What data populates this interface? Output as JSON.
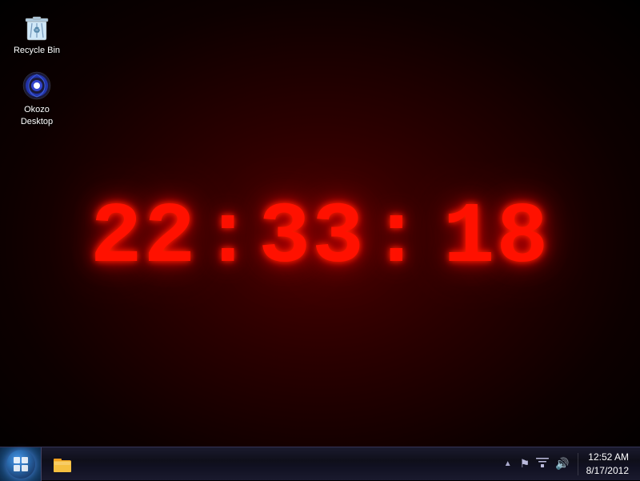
{
  "desktop": {
    "background": "radial dark red"
  },
  "icons": [
    {
      "id": "recycle-bin",
      "label": "Recycle Bin",
      "type": "recycle-bin"
    },
    {
      "id": "okozo-desktop",
      "label": "Okozo\nDesktop",
      "labelLine1": "Okozo",
      "labelLine2": "Desktop",
      "type": "okozo"
    }
  ],
  "clock": {
    "hours": "22",
    "minutes": "33",
    "seconds": "18",
    "display": "22:33: 18"
  },
  "taskbar": {
    "start_label": "Start",
    "pins": [
      {
        "label": "Windows Explorer",
        "icon": "folder"
      }
    ],
    "tray": {
      "time": "12:52 AM",
      "date": "8/17/2012",
      "icons": [
        "arrow-up",
        "flag",
        "network",
        "volume"
      ]
    }
  }
}
